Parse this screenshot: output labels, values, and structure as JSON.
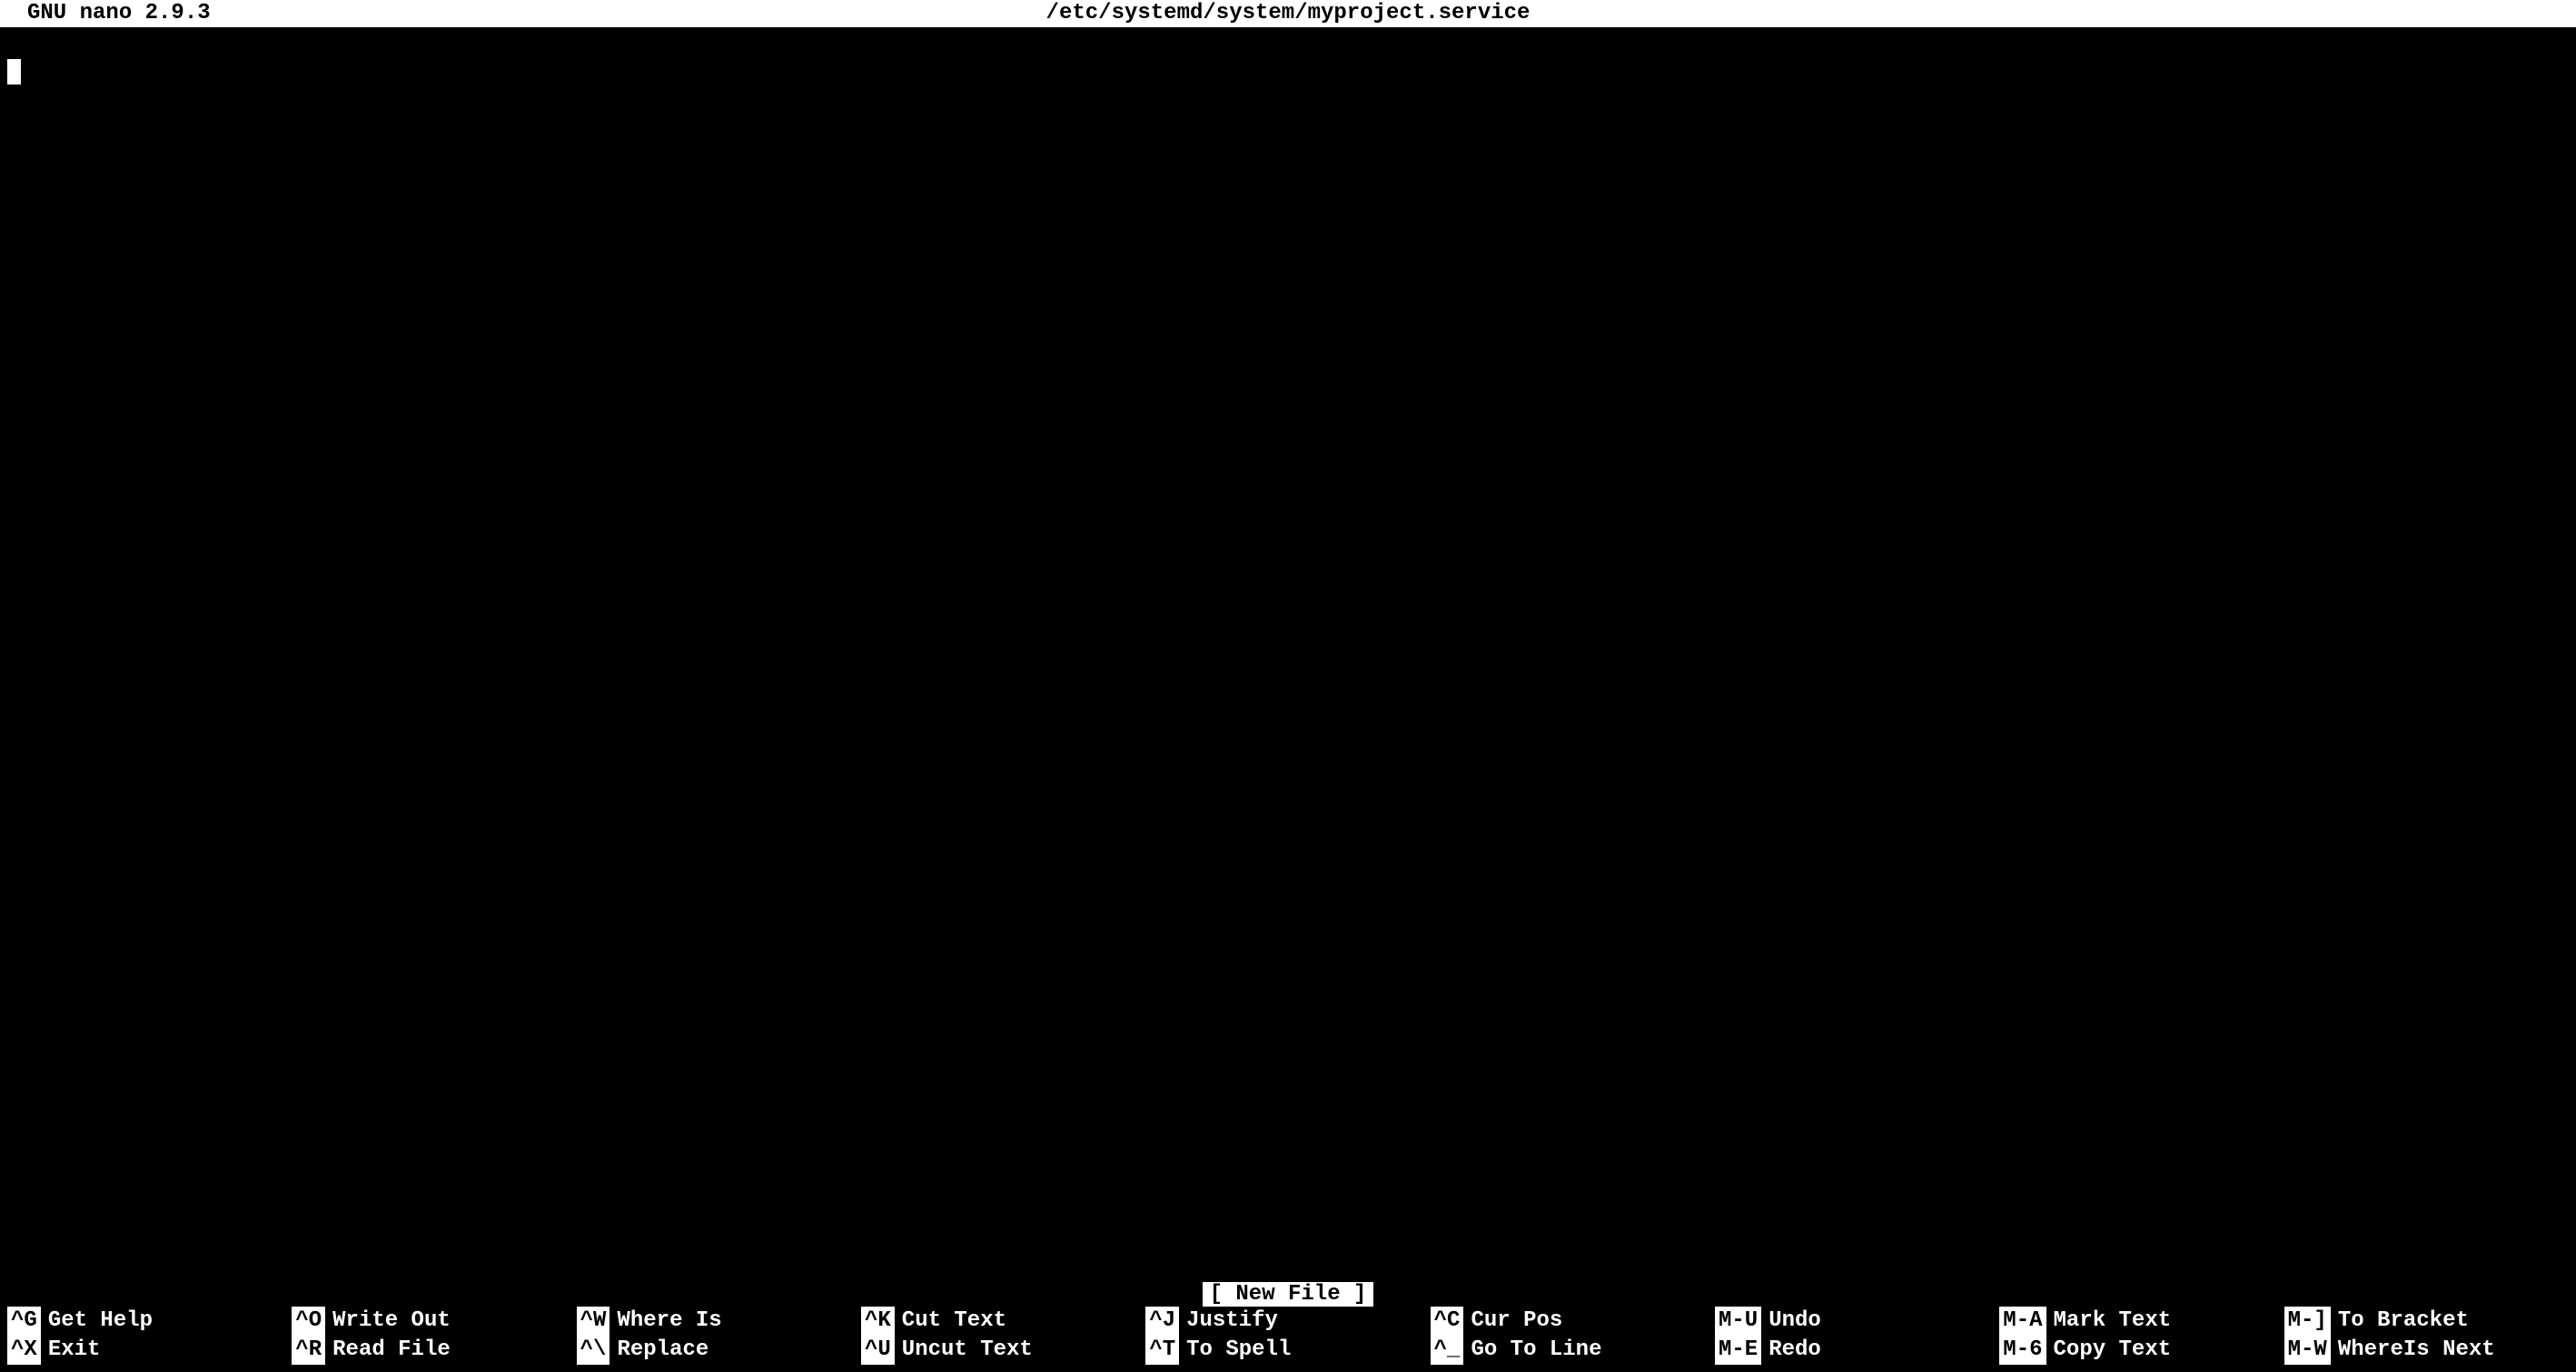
{
  "titlebar": {
    "app": "GNU nano 2.9.3",
    "file": "/etc/systemd/system/myproject.service"
  },
  "status": {
    "message": "[ New File ]"
  },
  "shortcuts": {
    "row1": [
      {
        "key": "^G",
        "label": "Get Help"
      },
      {
        "key": "^O",
        "label": "Write Out"
      },
      {
        "key": "^W",
        "label": "Where Is"
      },
      {
        "key": "^K",
        "label": "Cut Text"
      },
      {
        "key": "^J",
        "label": "Justify"
      },
      {
        "key": "^C",
        "label": "Cur Pos"
      },
      {
        "key": "M-U",
        "label": "Undo"
      },
      {
        "key": "M-A",
        "label": "Mark Text"
      },
      {
        "key": "M-]",
        "label": "To Bracket"
      }
    ],
    "row2": [
      {
        "key": "^X",
        "label": "Exit"
      },
      {
        "key": "^R",
        "label": "Read File"
      },
      {
        "key": "^\\",
        "label": "Replace"
      },
      {
        "key": "^U",
        "label": "Uncut Text"
      },
      {
        "key": "^T",
        "label": "To Spell"
      },
      {
        "key": "^_",
        "label": "Go To Line"
      },
      {
        "key": "M-E",
        "label": "Redo"
      },
      {
        "key": "M-6",
        "label": "Copy Text"
      },
      {
        "key": "M-W",
        "label": "WhereIs Next"
      }
    ]
  },
  "watermark": ""
}
